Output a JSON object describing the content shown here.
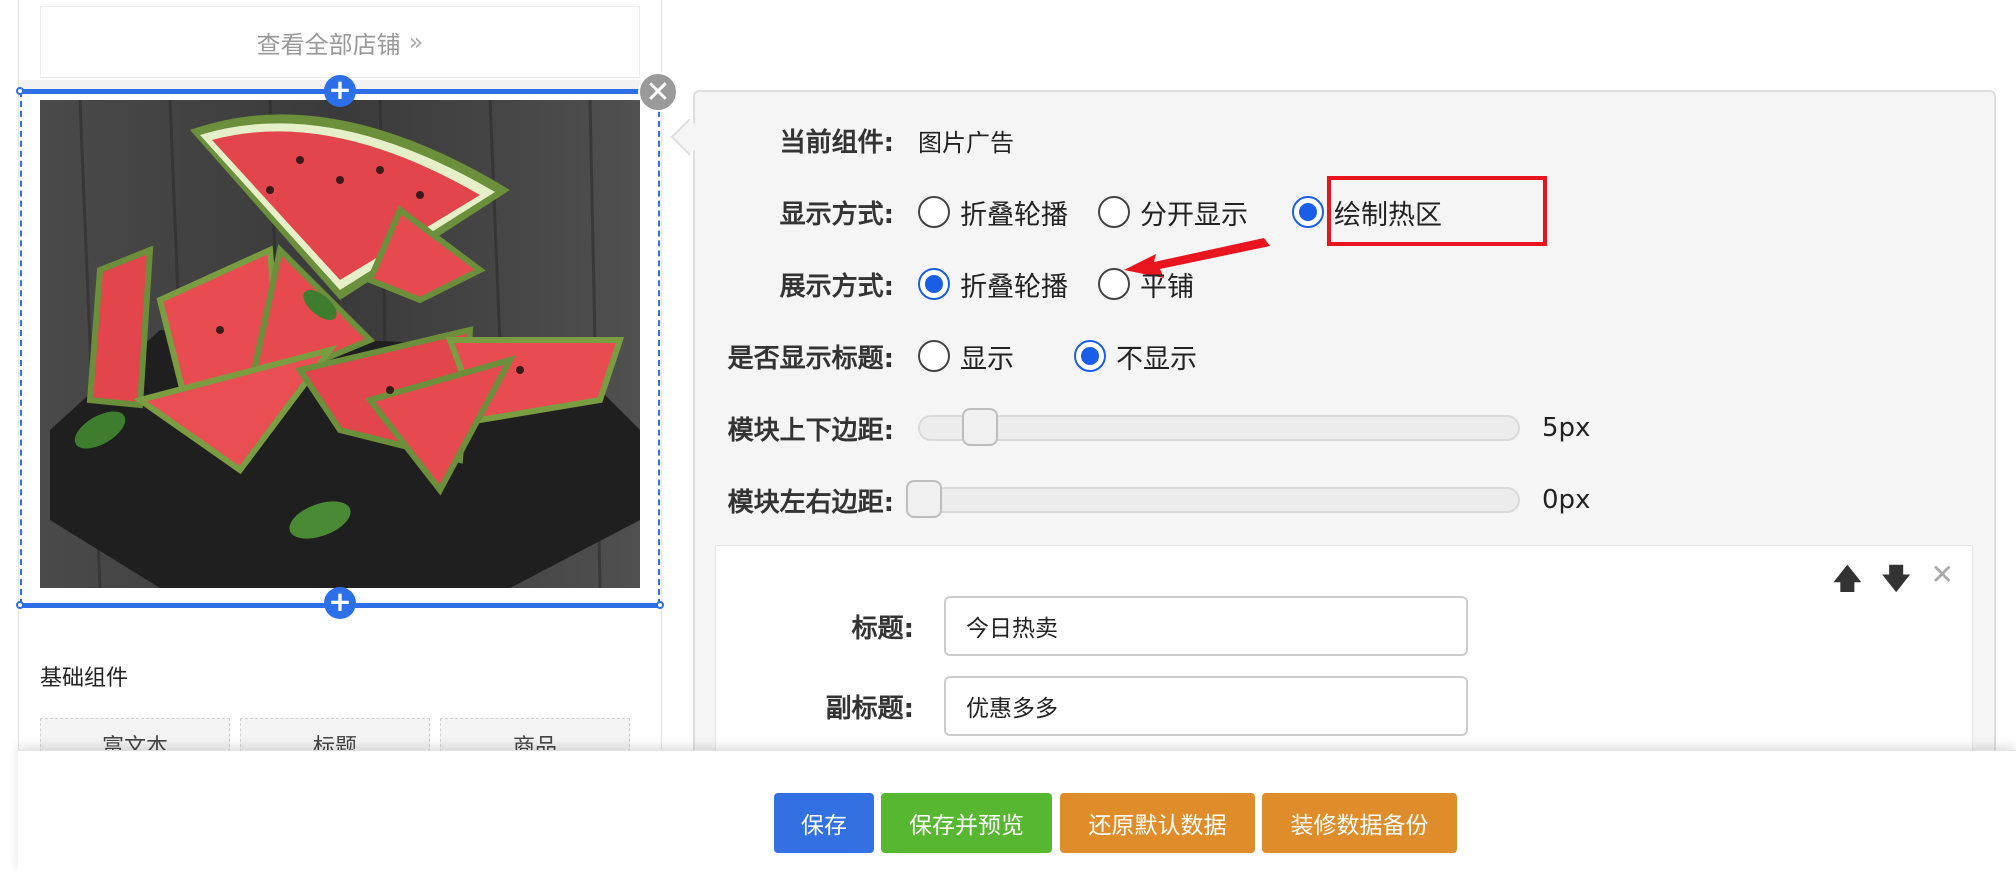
{
  "preview": {
    "view_all_shops": "查看全部店铺",
    "basic_components_title": "基础组件",
    "component_tiles": [
      "富文本",
      "标题",
      "商品"
    ]
  },
  "settings": {
    "current_component": {
      "label": "当前组件:",
      "value": "图片广告"
    },
    "display_mode": {
      "label": "显示方式:",
      "options": [
        "折叠轮播",
        "分开显示",
        "绘制热区"
      ],
      "selected": "绘制热区"
    },
    "show_mode": {
      "label": "展示方式:",
      "options": [
        "折叠轮播",
        "平铺"
      ],
      "selected": "折叠轮播"
    },
    "show_title": {
      "label": "是否显示标题:",
      "options": [
        "显示",
        "不显示"
      ],
      "selected": "不显示"
    },
    "vertical_margin": {
      "label": "模块上下边距:",
      "value_text": "5px",
      "value": 5
    },
    "horizontal_margin": {
      "label": "模块左右边距:",
      "value_text": "0px",
      "value": 0
    }
  },
  "item_card": {
    "title_label": "标题:",
    "title_value": "今日热卖",
    "subtitle_label": "副标题:",
    "subtitle_value": "优惠多多"
  },
  "actions": {
    "save": "保存",
    "save_preview": "保存并预览",
    "restore_default": "还原默认数据",
    "backup": "装修数据备份"
  },
  "colors": {
    "selection_blue": "#2d6fe9",
    "highlight_red": "#e8141e",
    "save_blue": "#3371e3",
    "preview_green": "#57b731",
    "orange": "#df8d2a"
  }
}
